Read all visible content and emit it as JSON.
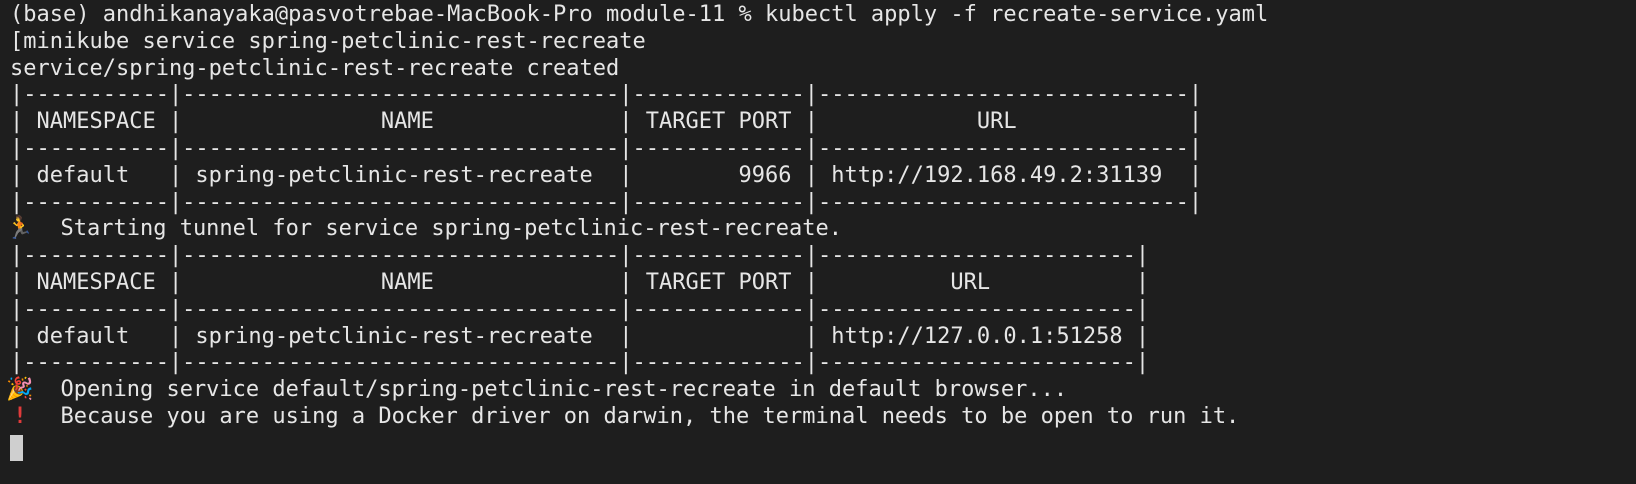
{
  "terminal": {
    "prompt": "(base) andhikanayaka@pasvotrebae-MacBook-Pro module-11 % kubectl apply -f recreate-service.yaml",
    "line2": "[minikube service spring-petclinic-rest-recreate",
    "line3": "service/spring-petclinic-rest-recreate created",
    "table1": {
      "sep": "|-----------|---------------------------------|-------------|----------------------------|",
      "header": "| NAMESPACE |               NAME              | TARGET PORT |            URL             |",
      "row": "| default   | spring-petclinic-rest-recreate  |        9966 | http://192.168.49.2:31139  |"
    },
    "tunnel_msg": "  Starting tunnel for service spring-petclinic-rest-recreate.",
    "table2": {
      "sep": "|-----------|---------------------------------|-------------|------------------------|",
      "header": "| NAMESPACE |               NAME              | TARGET PORT |          URL           |",
      "row": "| default   | spring-petclinic-rest-recreate  |             | http://127.0.0.1:51258 |"
    },
    "open_msg": "  Opening service default/spring-petclinic-rest-recreate in default browser...",
    "warn_msg": "  Because you are using a Docker driver on darwin, the terminal needs to be open to run it.",
    "icons": {
      "runner": "runner-icon",
      "party": "party-popper-icon",
      "warning": "exclamation-icon"
    },
    "colors": {
      "background": "#1e1e1e",
      "foreground": "#e6e6e6",
      "warning": "#e03b3b"
    }
  }
}
